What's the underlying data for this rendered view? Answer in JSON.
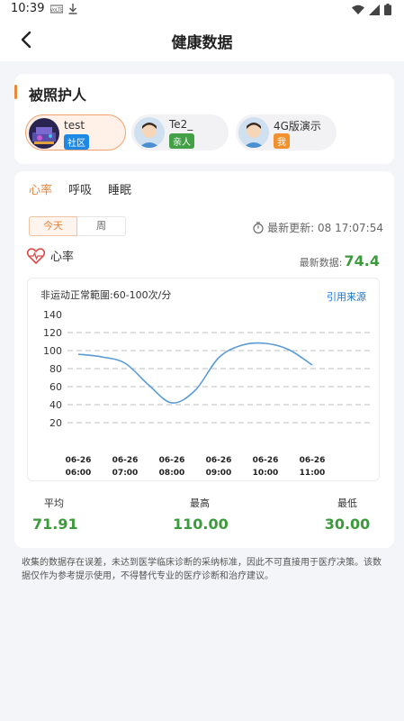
{
  "status": {
    "time": "10:39"
  },
  "header": {
    "title": "健康数据"
  },
  "ward": {
    "title": "被照护人",
    "people": [
      {
        "name": "test",
        "tag": "社区",
        "tag_color": "#1e88e5"
      },
      {
        "name": "Te2_",
        "tag": "亲人",
        "tag_color": "#43a047"
      },
      {
        "name": "4G版演示",
        "tag": "我",
        "tag_color": "#f0902f"
      }
    ]
  },
  "tabs": [
    "心率",
    "呼吸",
    "睡眠"
  ],
  "segment": {
    "today": "今天",
    "week": "周"
  },
  "last_update": "最新更新: 08 17:07:54",
  "heart": {
    "label": "心率",
    "latest_label": "最新数据:",
    "latest_value": "74.4"
  },
  "chart_head": {
    "range": "非运动正常範圍:60-100次/分",
    "cite": "引用来源"
  },
  "chart_data": {
    "type": "line",
    "y_ticks": [
      "140",
      "120",
      "100",
      "80",
      "60",
      "40",
      "20"
    ],
    "ylim": [
      20,
      140
    ],
    "x_ticks": [
      {
        "date": "06-26",
        "time": "06:00"
      },
      {
        "date": "06-26",
        "time": "07:00"
      },
      {
        "date": "06-26",
        "time": "08:00"
      },
      {
        "date": "06-26",
        "time": "09:00"
      },
      {
        "date": "06-26",
        "time": "10:00"
      },
      {
        "date": "06-26",
        "time": "11:00"
      }
    ],
    "series": [
      {
        "x": [
          6.0,
          6.5,
          7.0,
          7.5,
          8.0,
          8.5,
          9.0,
          9.5,
          10.0,
          10.5,
          11.0
        ],
        "values": [
          96,
          93,
          86,
          62,
          42,
          56,
          92,
          106,
          108,
          101,
          84
        ]
      }
    ],
    "line_color": "#5b9bd5"
  },
  "stats": {
    "avg": {
      "label": "平均",
      "value": "71.91"
    },
    "max": {
      "label": "最高",
      "value": "110.00"
    },
    "min": {
      "label": "最低",
      "value": "30.00"
    }
  },
  "disclaimer": "收集的数据存在误差，未达到医学临床诊断的采纳标准，因此不可直接用于医疗决策。该数据仅作为参考提示使用，不得替代专业的医疗诊断和治疗建议。"
}
